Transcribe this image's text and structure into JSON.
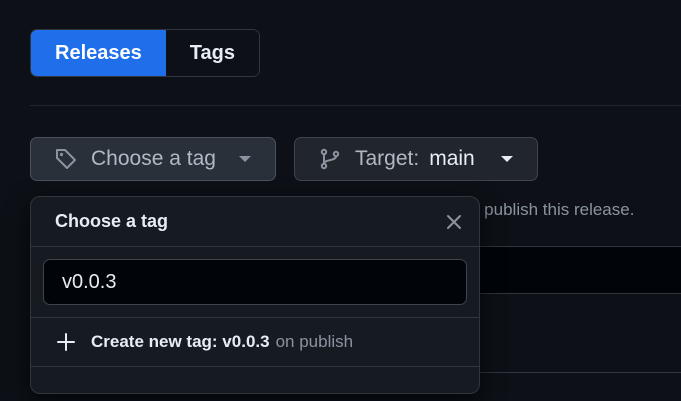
{
  "tabs": [
    {
      "label": "Releases",
      "active": true
    },
    {
      "label": "Tags",
      "active": false
    }
  ],
  "tag_button": {
    "label": "Choose a tag",
    "icon": "tag-icon"
  },
  "target_button": {
    "label": "Target:",
    "value": "main",
    "icon": "git-branch-icon"
  },
  "helper_text": "u publish this release.",
  "dropdown": {
    "title": "Choose a tag",
    "search_value": "v0.0.3",
    "create_item": {
      "prefix": "Create new tag: v0.0.3",
      "suffix": "on publish"
    }
  },
  "colors": {
    "accent": "#1f6feb",
    "background": "#0d1117",
    "panel": "#161b22"
  }
}
